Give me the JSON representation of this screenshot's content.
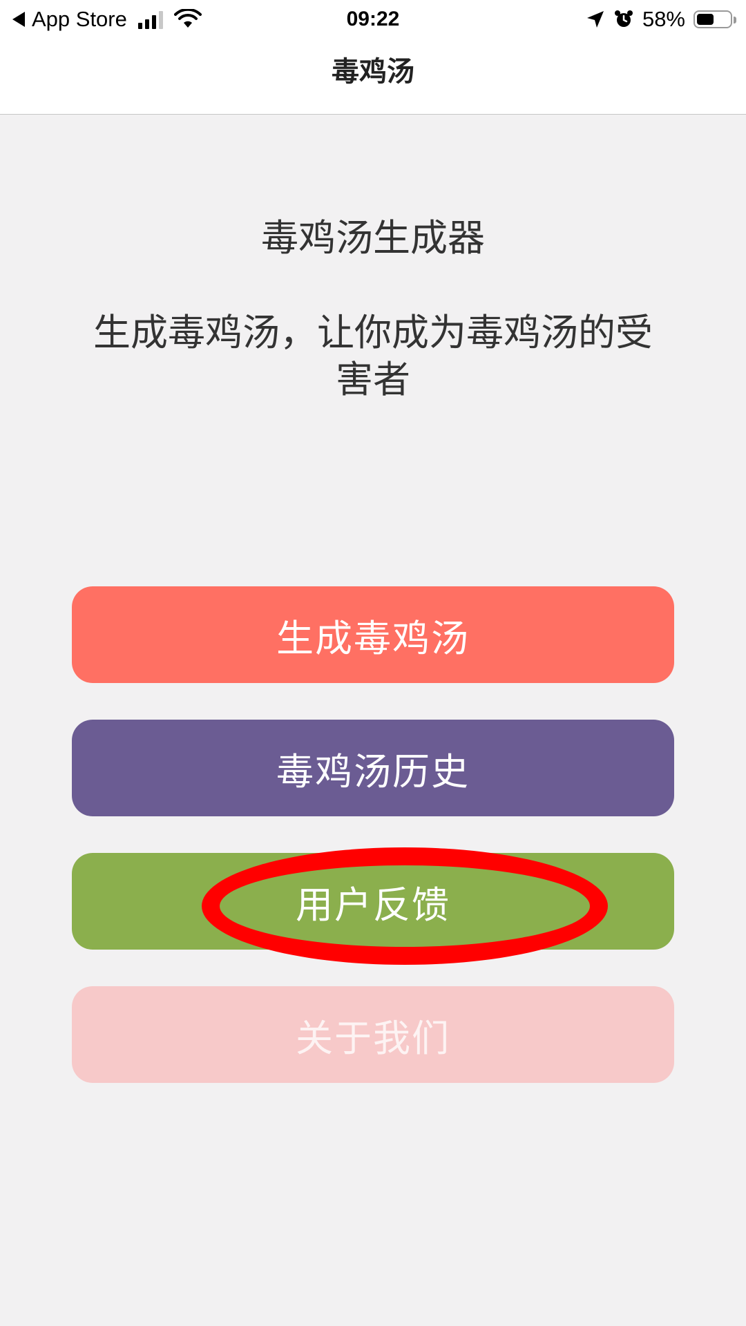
{
  "status_bar": {
    "back_label": "App Store",
    "time": "09:22",
    "battery_percent": "58%",
    "battery_level": 0.58,
    "icons": [
      "back-arrow-icon",
      "cellular-signal-icon",
      "wifi-icon",
      "location-arrow-icon",
      "alarm-clock-icon",
      "battery-icon"
    ]
  },
  "nav": {
    "title": "毒鸡汤"
  },
  "main": {
    "title": "毒鸡汤生成器",
    "subtitle": "生成毒鸡汤，让你成为毒鸡汤的受害者"
  },
  "buttons": {
    "generate": "生成毒鸡汤",
    "history": "毒鸡汤历史",
    "feedback": "用户反馈",
    "about": "关于我们"
  },
  "colors": {
    "background": "#f2f1f2",
    "generate": "#ff7063",
    "history": "#6b5c93",
    "feedback": "#8baf4d",
    "about": "#f7c9c9",
    "highlight": "#ff0000"
  }
}
